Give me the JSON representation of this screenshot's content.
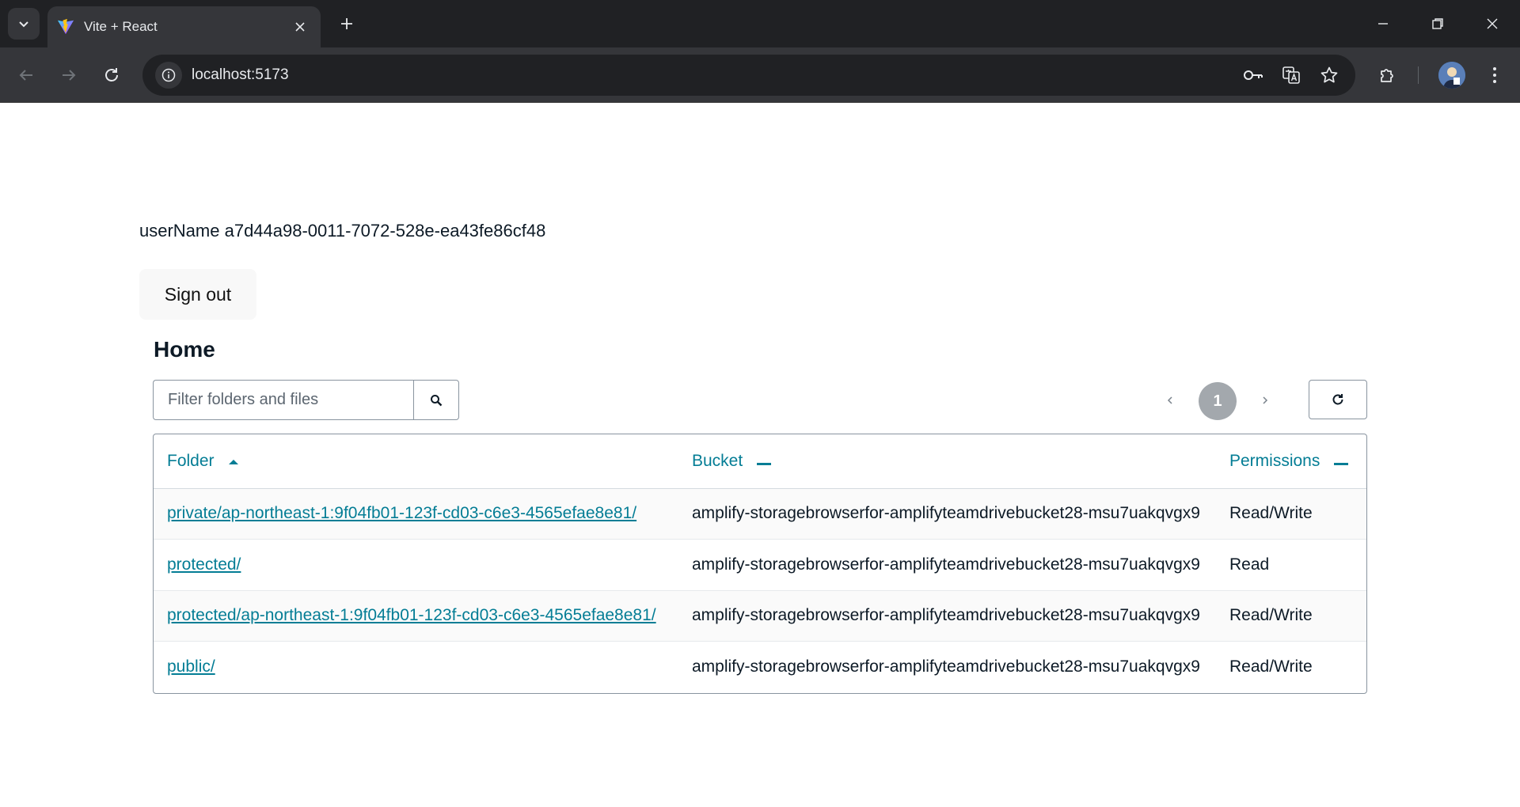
{
  "browser": {
    "tab_title": "Vite + React",
    "url": "localhost:5173"
  },
  "page": {
    "username_text": "userName a7d44a98-0011-7072-528e-ea43fe86cf48",
    "signout_label": "Sign out",
    "title": "Home",
    "search_placeholder": "Filter folders and files",
    "current_page": "1",
    "columns": {
      "folder": "Folder",
      "bucket": "Bucket",
      "permissions": "Permissions"
    },
    "rows": [
      {
        "folder": "private/ap-northeast-1:9f04fb01-123f-cd03-c6e3-4565efae8e81/",
        "bucket": "amplify-storagebrowserfor-amplifyteamdrivebucket28-msu7uakqvgx9",
        "permissions": "Read/Write"
      },
      {
        "folder": "protected/",
        "bucket": "amplify-storagebrowserfor-amplifyteamdrivebucket28-msu7uakqvgx9",
        "permissions": "Read"
      },
      {
        "folder": "protected/ap-northeast-1:9f04fb01-123f-cd03-c6e3-4565efae8e81/",
        "bucket": "amplify-storagebrowserfor-amplifyteamdrivebucket28-msu7uakqvgx9",
        "permissions": "Read/Write"
      },
      {
        "folder": "public/",
        "bucket": "amplify-storagebrowserfor-amplifyteamdrivebucket28-msu7uakqvgx9",
        "permissions": "Read/Write"
      }
    ]
  },
  "colors": {
    "accent": "#047d95",
    "chrome_dark": "#202124",
    "chrome_toolbar": "#35363a"
  }
}
